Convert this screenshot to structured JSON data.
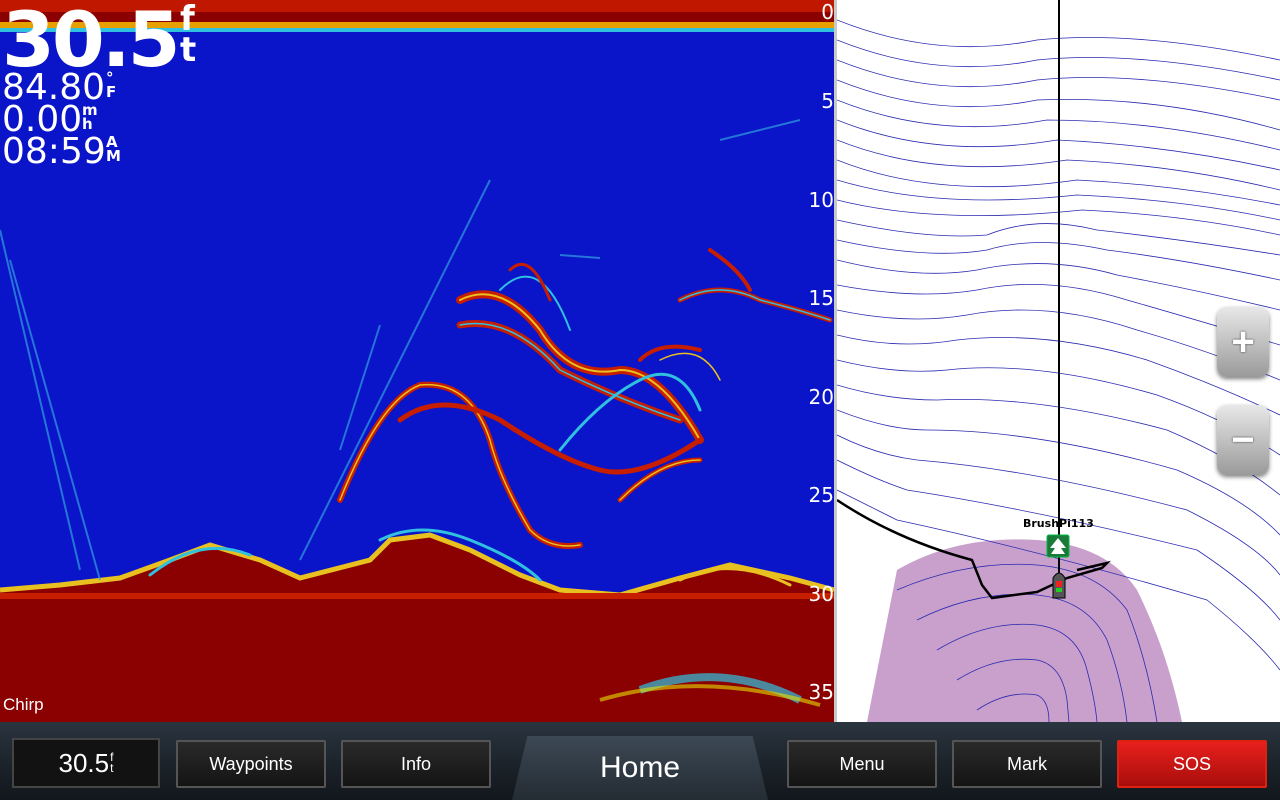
{
  "sonar": {
    "depth_value": "30.5",
    "depth_unit_top": "f",
    "depth_unit_bottom": "t",
    "water_temp": "84.80",
    "temp_unit_top": "°",
    "temp_unit_bottom": "F",
    "speed": "0.00",
    "speed_unit_top": "m",
    "speed_unit_bottom": "h",
    "time": "08:59",
    "time_unit_top": "A",
    "time_unit_bottom": "M",
    "mode_label": "Chirp",
    "depth_scale": [
      "0",
      "5",
      "10",
      "15",
      "20",
      "25",
      "30",
      "35"
    ]
  },
  "map": {
    "waypoint_label": "BrushPi113",
    "zoom_in_label": "+",
    "zoom_out_label": "−"
  },
  "bottombar": {
    "depth_value": "30.5",
    "depth_unit_top": "f",
    "depth_unit_bottom": "t",
    "waypoints_label": "Waypoints",
    "info_label": "Info",
    "home_label": "Home",
    "menu_label": "Menu",
    "mark_label": "Mark",
    "sos_label": "SOS"
  },
  "colors": {
    "sonar_water": "#0a14c8",
    "sonar_bottom": "#8b0000",
    "sonar_return_hot": "#c81e00",
    "contour_line": "#2a2ab0",
    "shallow_area": "#c9a0cc",
    "sos_red": "#e8201c"
  },
  "icons": {
    "waypoint": "tree-waypoint-icon",
    "boat": "boat-position-icon"
  }
}
